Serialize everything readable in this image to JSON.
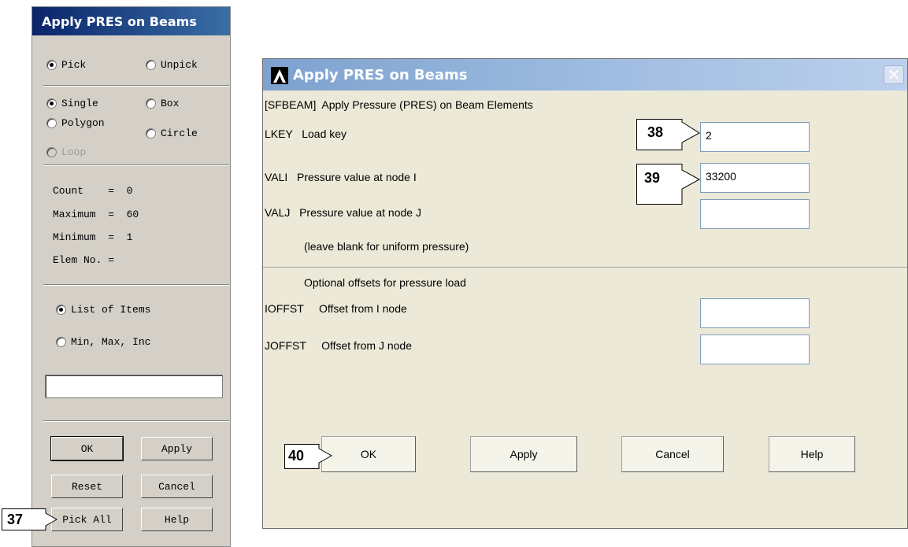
{
  "picker": {
    "title": "Apply PRES on Beams",
    "mode_options": [
      {
        "label": "Pick",
        "selected": true
      },
      {
        "label": "Unpick",
        "selected": false
      }
    ],
    "shape_options": [
      {
        "label": "Single",
        "selected": true
      },
      {
        "label": "Box",
        "selected": false
      },
      {
        "label": "Polygon",
        "selected": false
      },
      {
        "label": "Circle",
        "selected": false
      },
      {
        "label": "Loop",
        "selected": false,
        "disabled": true
      }
    ],
    "stats": {
      "count": "Count    =  0",
      "maximum": "Maximum  =  60",
      "minimum": "Minimum  =  1",
      "elem_no": "Elem No. ="
    },
    "list_options": [
      {
        "label": "List of Items",
        "selected": true
      },
      {
        "label": "Min, Max, Inc",
        "selected": false
      }
    ],
    "input_value": "",
    "buttons": {
      "ok": "OK",
      "apply": "Apply",
      "reset": "Reset",
      "cancel": "Cancel",
      "pick_all": "Pick All",
      "help": "Help"
    }
  },
  "dialog": {
    "title": "Apply PRES on Beams",
    "command": "[SFBEAM]  Apply Pressure (PRES) on Beam Elements",
    "fields": {
      "lkey": {
        "label": "LKEY   Load key",
        "value": "2"
      },
      "vali": {
        "label": "VALI   Pressure value at node I",
        "value": "33200"
      },
      "valj": {
        "label": "VALJ   Pressure value at node J",
        "value": ""
      },
      "note": "(leave blank for uniform pressure)",
      "offsets_header": "Optional offsets for pressure load",
      "ioffst": {
        "label": "IOFFST     Offset from I node",
        "value": ""
      },
      "joffst": {
        "label": "JOFFST     Offset from J node",
        "value": ""
      }
    },
    "buttons": {
      "ok": "OK",
      "apply": "Apply",
      "cancel": "Cancel",
      "help": "Help"
    }
  },
  "callouts": {
    "c37": "37",
    "c38": "38",
    "c39": "39",
    "c40": "40"
  }
}
